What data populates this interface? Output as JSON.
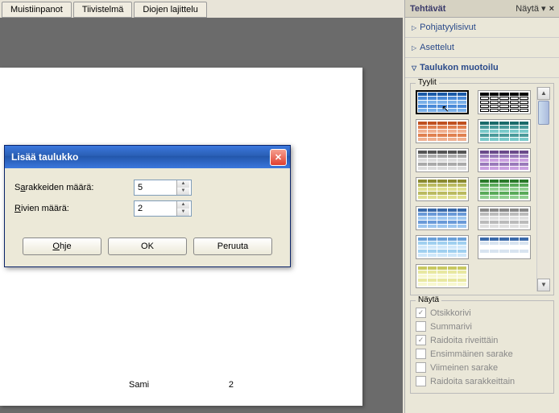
{
  "tabs": [
    "Muistiinpanot",
    "Tiivistelmä",
    "Diojen lajittelu"
  ],
  "page": {
    "author": "Sami",
    "number": "2"
  },
  "dialog": {
    "title": "Lisää taulukko",
    "cols_label_pre": "S",
    "cols_label_u": "a",
    "cols_label_post": "rakkeiden määrä:",
    "rows_label_pre": "",
    "rows_label_u": "R",
    "rows_label_post": "ivien määrä:",
    "cols_value": "5",
    "rows_value": "2",
    "help_u": "O",
    "help_rest": "hje",
    "ok": "OK",
    "cancel": "Peruuta"
  },
  "taskpane": {
    "title": "Tehtävät",
    "show_label": "Näytä",
    "sections": {
      "master": "Pohjatyylisivut",
      "layouts": "Asettelut",
      "table": "Taulukon muotoilu"
    },
    "styles_legend": "Tyylit",
    "display_legend": "Näytä",
    "checks": {
      "header": "Otsikkorivi",
      "total": "Summarivi",
      "rowstripe": "Raidoita riveittäin",
      "firstcol": "Ensimmäinen sarake",
      "lastcol": "Viimeinen sarake",
      "colstripe": "Raidoita sarakkeittain"
    }
  }
}
